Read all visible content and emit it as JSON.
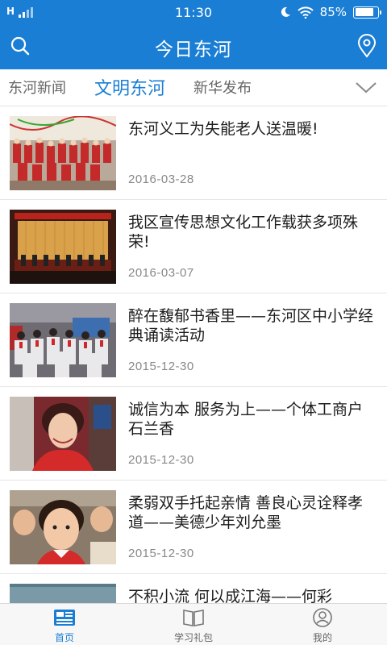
{
  "status_bar": {
    "network": "H",
    "time": "11:30",
    "battery_percent": "85%",
    "battery_level": 0.85,
    "icons": [
      "moon-icon",
      "wifi-icon",
      "battery-icon"
    ]
  },
  "app_bar": {
    "title": "今日东河",
    "left_icon": "search-icon",
    "right_icon": "location-pin-icon"
  },
  "tabs": [
    {
      "label": "东河新闻",
      "active": false
    },
    {
      "label": "文明东河",
      "active": true
    },
    {
      "label": "新华发布",
      "active": false
    }
  ],
  "tabs_more_icon": "chevron-down-icon",
  "articles": [
    {
      "title": "东河义工为失能老人送温暖!",
      "date": "2016-03-28"
    },
    {
      "title": "我区宣传思想文化工作载获多项殊荣!",
      "date": "2016-03-07"
    },
    {
      "title": "醉在馥郁书香里——东河区中小学经典诵读活动",
      "date": "2015-12-30"
    },
    {
      "title": "诚信为本 服务为上——个体工商户石兰香",
      "date": "2015-12-30"
    },
    {
      "title": "柔弱双手托起亲情 善良心灵诠释孝道——美德少年刘允墨",
      "date": "2015-12-30"
    },
    {
      "title": "不积小流 何以成江海——何彩",
      "date": ""
    }
  ],
  "bottom_nav": [
    {
      "label": "首页",
      "icon": "home-newspaper-icon",
      "active": true
    },
    {
      "label": "学习礼包",
      "icon": "book-icon",
      "active": false
    },
    {
      "label": "我的",
      "icon": "user-icon",
      "active": false
    }
  ],
  "colors": {
    "primary": "#1a7ed4",
    "text": "#1d1d1d",
    "muted": "#888888"
  }
}
